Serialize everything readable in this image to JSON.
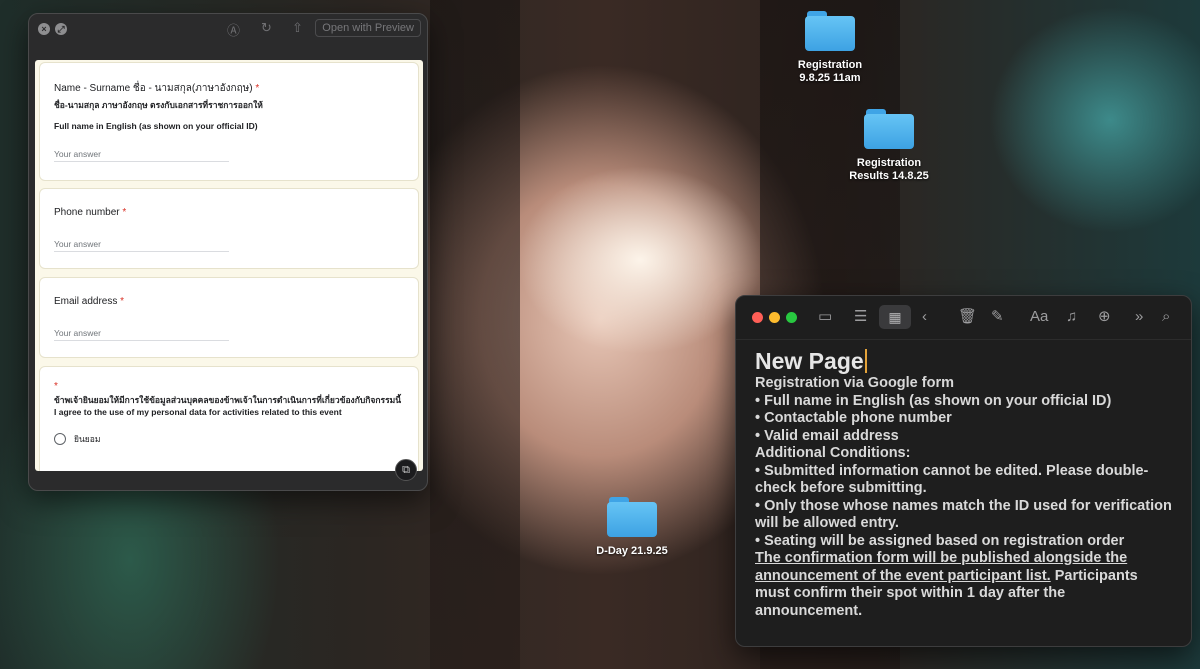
{
  "desktop": {
    "folders": [
      {
        "label_line1": "Registration",
        "label_line2": "9.8.25 11am"
      },
      {
        "label_line1": "Registration",
        "label_line2": "Results 14.8.25"
      },
      {
        "label_line1": "D-Day 21.9.25",
        "label_line2": ""
      }
    ]
  },
  "preview": {
    "open_button": "Open with Preview",
    "form": {
      "q1": {
        "title": "Name - Surname ชื่อ - นามสกุล(ภาษาอังกฤษ)",
        "required": "*",
        "desc_th": "ชื่อ-นามสกุล ภาษาอังกฤษ ตรงกับเอกสารที่ราชการออกให้",
        "desc_en": "Full name in English (as shown on your official ID)",
        "answer_placeholder": "Your answer"
      },
      "q2": {
        "title": "Phone number",
        "required": "*",
        "answer_placeholder": "Your answer"
      },
      "q3": {
        "title": "Email address",
        "required": "*",
        "answer_placeholder": "Your answer"
      },
      "q4": {
        "required": "*",
        "desc_th": "ข้าพเจ้ายินยอมให้มีการใช้ข้อมูลส่วนบุคคลของข้าพเจ้าในการดำเนินการที่เกี่ยวข้องกับกิจกรรมนี้",
        "desc_en": "I agree to the use of my personal data for activities related to this event",
        "option": "ยินยอม"
      }
    }
  },
  "notes": {
    "title": "New Page",
    "format_label": "Aa",
    "lines": [
      "Registration via Google form",
      "• Full name in English (as shown on your official ID)",
      "• Contactable phone number",
      "• Valid email address",
      "Additional Conditions:",
      "• Submitted information cannot be edited. Please double-check before submitting.",
      "• Only those whose names match the ID used for verification will be allowed entry.",
      "• Seating will be assigned based on registration order"
    ],
    "underlined": "The confirmation form will be published alongside the announcement of the event participant list.",
    "closing": " Participants must confirm their spot within 1 day after the announcement."
  }
}
